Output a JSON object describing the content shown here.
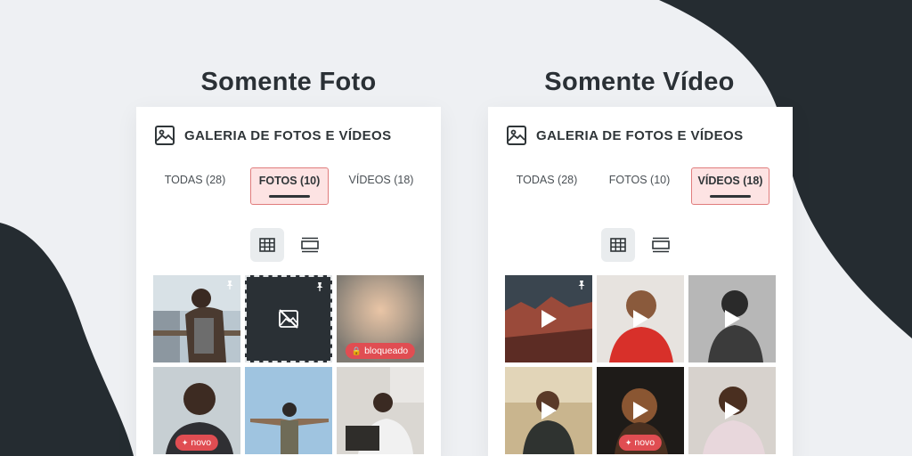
{
  "panels": [
    {
      "heading": "Somente Foto",
      "gallery_title": "GALERIA DE FOTOS E VÍDEOS",
      "tabs": [
        {
          "label": "TODAS (28)",
          "active": false
        },
        {
          "label": "FOTOS (10)",
          "active": true
        },
        {
          "label": "VÍDEOS (18)",
          "active": false
        }
      ],
      "view_modes": [
        "grid-icon",
        "list-icon"
      ],
      "items": [
        {
          "kind": "photo",
          "pinned": true,
          "badge": ""
        },
        {
          "kind": "no-image",
          "pinned": true,
          "badge": ""
        },
        {
          "kind": "blurred",
          "pinned": false,
          "badge": "bloqueado",
          "badge_icon": "lock-icon"
        },
        {
          "kind": "photo",
          "pinned": false,
          "badge": "novo",
          "badge_icon": "sparkle-icon"
        },
        {
          "kind": "photo",
          "pinned": false,
          "badge": ""
        },
        {
          "kind": "photo",
          "pinned": false,
          "badge": ""
        }
      ]
    },
    {
      "heading": "Somente Vídeo",
      "gallery_title": "GALERIA DE FOTOS E VÍDEOS",
      "tabs": [
        {
          "label": "TODAS (28)",
          "active": false
        },
        {
          "label": "FOTOS (10)",
          "active": false
        },
        {
          "label": "VÍDEOS (18)",
          "active": true
        }
      ],
      "view_modes": [
        "grid-icon",
        "list-icon"
      ],
      "items": [
        {
          "kind": "video",
          "pinned": true,
          "badge": ""
        },
        {
          "kind": "video",
          "pinned": false,
          "badge": ""
        },
        {
          "kind": "video",
          "pinned": false,
          "badge": ""
        },
        {
          "kind": "video",
          "pinned": false,
          "badge": ""
        },
        {
          "kind": "video",
          "pinned": false,
          "badge": "novo",
          "badge_icon": "sparkle-icon"
        },
        {
          "kind": "video",
          "pinned": false,
          "badge": ""
        }
      ]
    }
  ],
  "colors": {
    "background": "#eef0f3",
    "dark_shape": "#252c31",
    "accent_badge": "#e04d52",
    "active_tab_bg": "#fde3e3",
    "active_tab_border": "#e07c7c"
  }
}
